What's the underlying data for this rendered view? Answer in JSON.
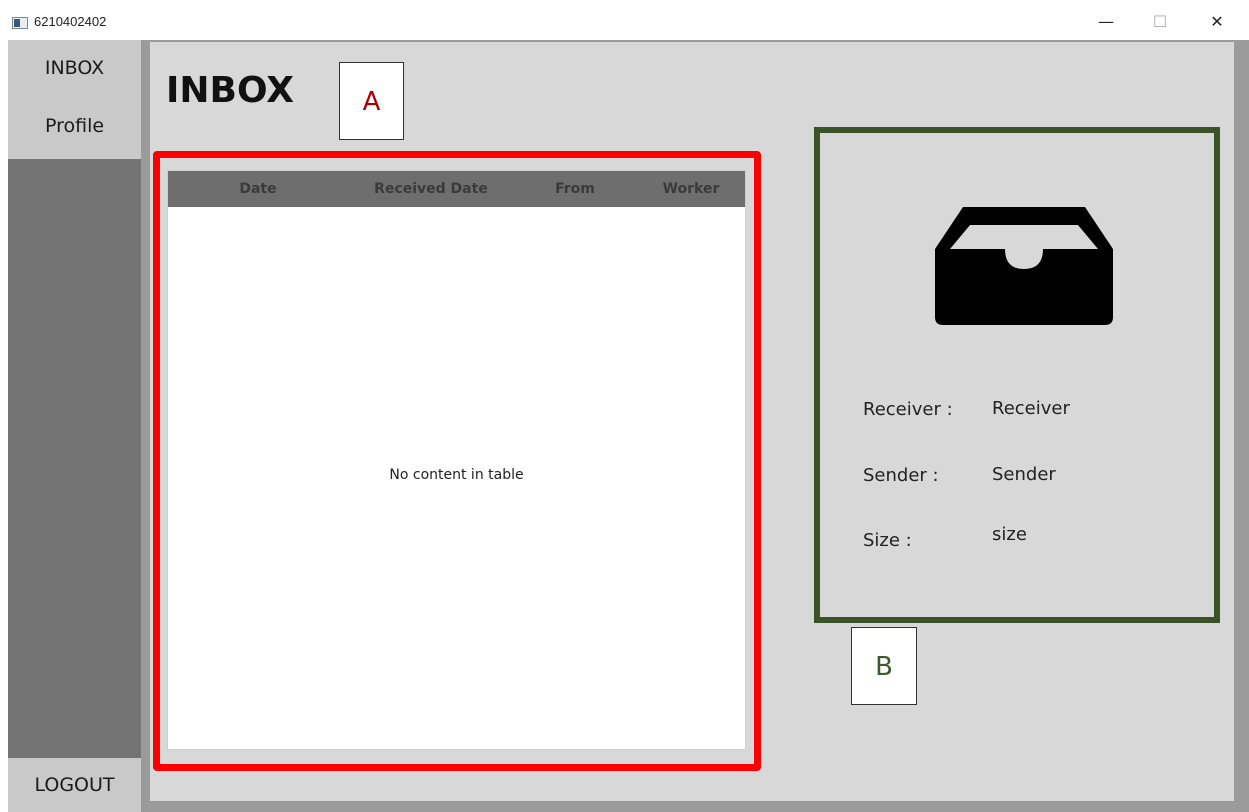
{
  "window": {
    "title": "6210402402",
    "minimize_glyph": "—",
    "maximize_glyph": "☐",
    "close_glyph": "✕"
  },
  "sidebar": {
    "items": [
      {
        "label": "INBOX"
      },
      {
        "label": "Profile"
      }
    ],
    "logout_label": "LOGOUT"
  },
  "main": {
    "title": "INBOX",
    "annotation_a": "A",
    "annotation_b": "B"
  },
  "table": {
    "columns": [
      "Date",
      "Received Date",
      "From",
      "Worker"
    ],
    "rows": [],
    "empty_message": "No content in table"
  },
  "detail": {
    "icon": "inbox-tray-icon",
    "receiver_label": "Receiver :",
    "receiver_value": "Receiver",
    "sender_label": "Sender :",
    "sender_value": "Sender",
    "size_label": "Size :",
    "size_value": "size"
  },
  "colors": {
    "table_highlight": "#ff0000",
    "detail_highlight": "#3a5228",
    "annotation_a": "#b00000",
    "annotation_b": "#3d5a2c"
  }
}
